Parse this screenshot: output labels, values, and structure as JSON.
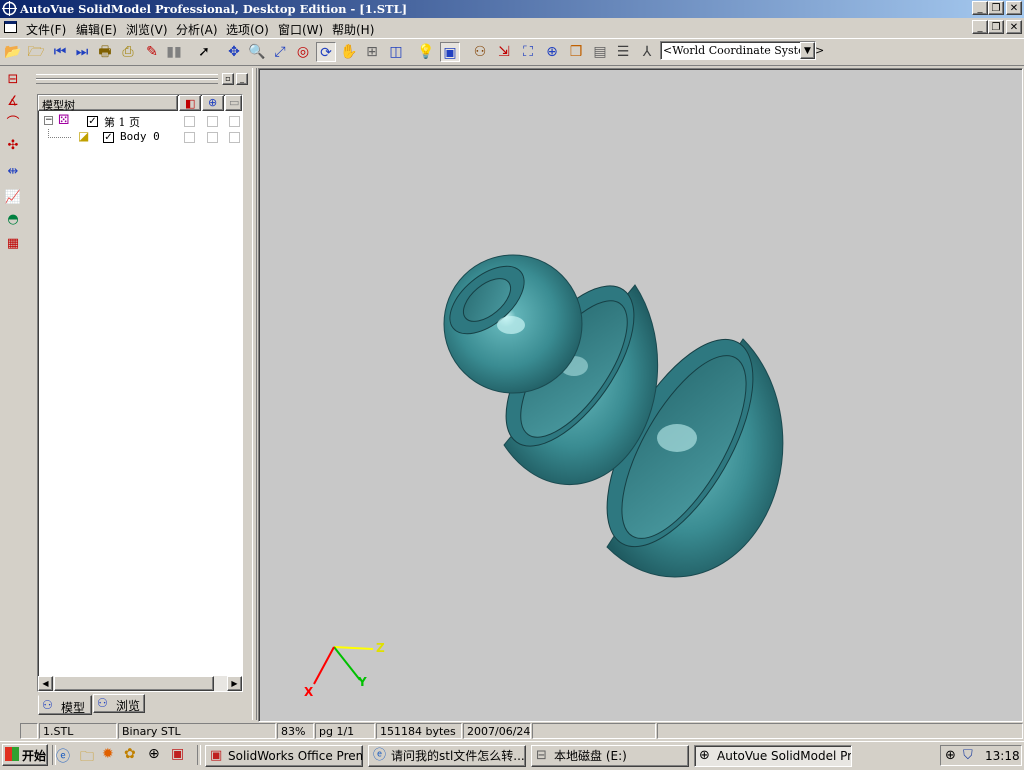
{
  "window": {
    "title": "AutoVue SolidModel Professional, Desktop Edition - [1.STL]"
  },
  "menu": [
    "文件(F)",
    "编辑(E)",
    "浏览(V)",
    "分析(A)",
    "选项(O)",
    "窗口(W)",
    "帮助(H)"
  ],
  "toolbar": {
    "coordinate_system": "<World Coordinate System>"
  },
  "tree": {
    "header_label": "模型树",
    "nodes": [
      {
        "label": "第 1 页",
        "checked": true
      },
      {
        "label": "Body 0",
        "checked": true
      }
    ]
  },
  "panel_tabs": [
    "模型",
    "浏览"
  ],
  "axes": {
    "x": "X",
    "y": "Y",
    "z": "Z"
  },
  "colors": {
    "accent_title": "#0a246a",
    "model_surface": "#3a8c92",
    "viewport_bg": "#c8c8c8",
    "axis_x": "#ff0000",
    "axis_y": "#00c000",
    "axis_z": "#ffff00"
  },
  "status": {
    "file": "1.STL",
    "format": "Binary STL",
    "zoom": "83%",
    "page": "pg 1/1",
    "size": "151184 bytes",
    "date": "2007/06/24"
  },
  "taskbar": {
    "start_label": "开始",
    "tasks": [
      "SolidWorks Office Premiu...",
      "请问我的stl文件怎么转...",
      "本地磁盘 (E:)",
      "AutoVue SolidModel Prof..."
    ],
    "clock": "13:18"
  }
}
